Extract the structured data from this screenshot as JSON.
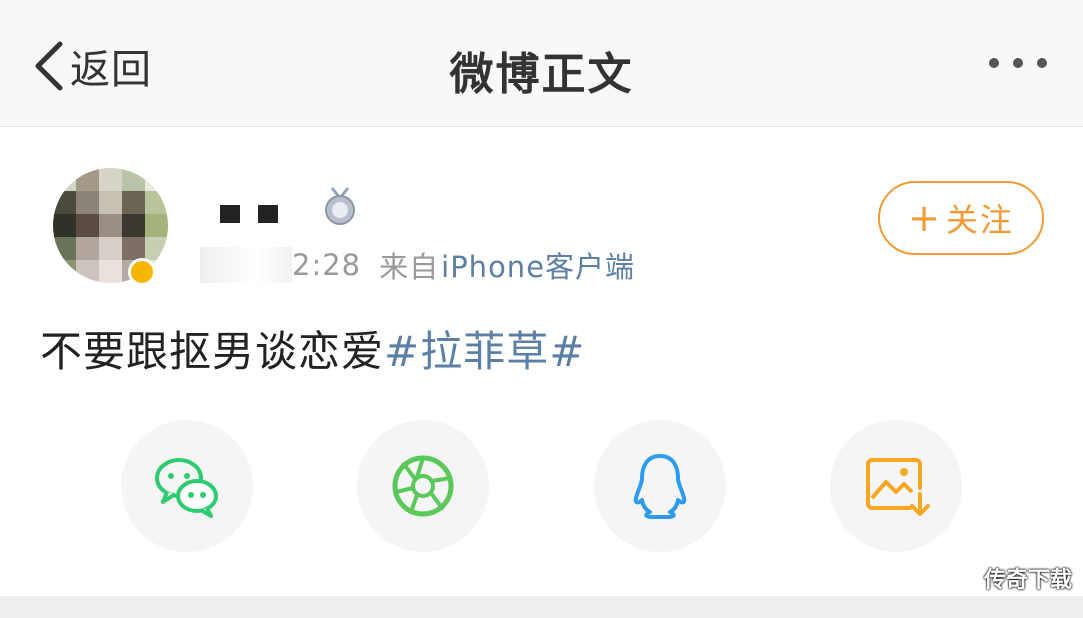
{
  "nav": {
    "back_label": "返回",
    "title": "微博正文",
    "more_icon": "more-dots-icon"
  },
  "post": {
    "time_visible": "2:28",
    "source_prefix": "来自",
    "source": "iPhone客户端",
    "follow_label": "关注",
    "follow_plus": "+",
    "text": "不要跟抠男谈恋爱",
    "hashtag": "#拉菲草#"
  },
  "share": {
    "icons": [
      "wechat-icon",
      "moments-icon",
      "qq-icon",
      "save-image-icon"
    ]
  },
  "watermark": "传奇下载",
  "colors": {
    "accent_orange": "#f39a34",
    "link_blue": "#5b7fa7",
    "wechat_green": "#2ecc71",
    "qq_blue": "#2d9cf0",
    "save_orange": "#f5a623"
  }
}
